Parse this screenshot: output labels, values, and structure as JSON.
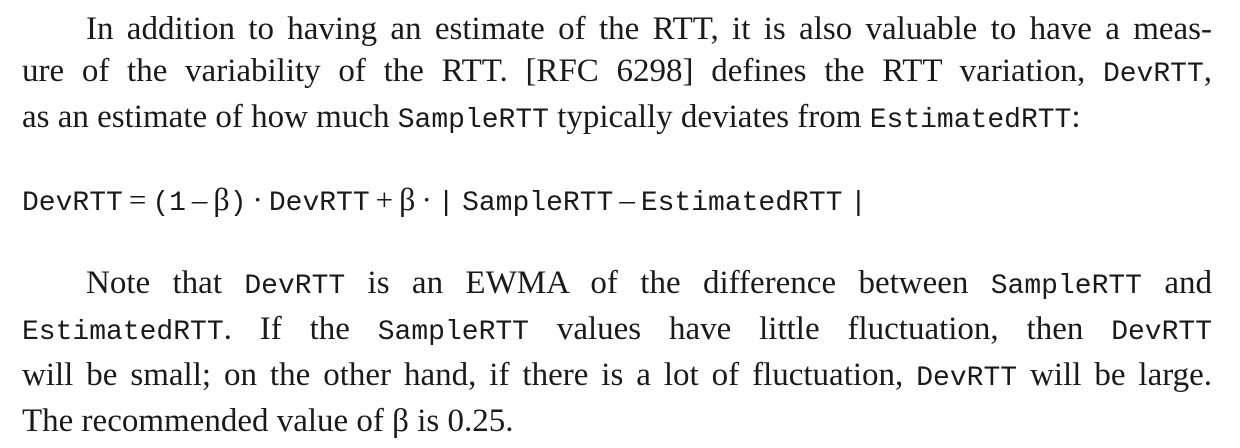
{
  "paragraph1": {
    "line1": "In addition to having an estimate of the RTT, it is also valuable to have a meas-",
    "line2_a": "ure of the variability of the RTT. [RFC 6298] defines the RTT variation,",
    "line2_code": "DevRTT",
    "line2_b": ",",
    "line3_a": "as an estimate of how much",
    "line3_code1": "SampleRTT",
    "line3_b": "typically deviates from",
    "line3_code2": "EstimatedRTT",
    "line3_c": ":"
  },
  "equation": {
    "lhs": "DevRTT",
    "equals": "=",
    "paren_open": "(1",
    "minus1": "–",
    "beta1": "β",
    "paren_close": ")",
    "dot1": "·",
    "term1": "DevRTT",
    "plus": "+",
    "beta2": "β",
    "dot2": "·",
    "bar_open": "|",
    "term2": "SampleRTT",
    "minus2": "–",
    "term3": "EstimatedRTT",
    "bar_close": "|"
  },
  "paragraph2": {
    "line1_a": "Note that",
    "line1_code1": "DevRTT",
    "line1_b": "is an EWMA of the difference between",
    "line1_code2": "SampleRTT",
    "line1_c": "and",
    "line2_code1": "EstimatedRTT",
    "line2_a": ". If the",
    "line2_code2": "SampleRTT",
    "line2_b": "values have little fluctuation, then",
    "line2_code3": "DevRTT",
    "line3_a": "will be small; on the other hand, if there is a lot of fluctuation,",
    "line3_code": "DevRTT",
    "line3_b": "will be large.",
    "line4": "The recommended value of β is 0.25."
  }
}
